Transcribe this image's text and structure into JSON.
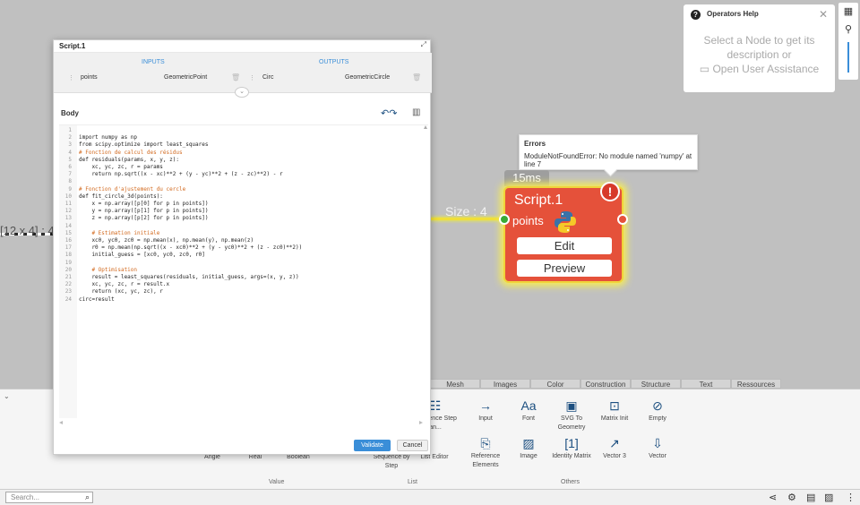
{
  "canvas": {
    "left_wire_label": "[12 x 4] : 4",
    "right_wire_label": "Size : 4"
  },
  "node": {
    "timing": "15ms",
    "title": "Script.1",
    "alert": "!",
    "port_label": "points",
    "edit_label": "Edit",
    "preview_label": "Preview",
    "color": "#e5513a"
  },
  "error": {
    "title": "Errors",
    "message": "ModuleNotFoundError: No module named 'numpy' at line 7"
  },
  "help": {
    "title": "Operators Help",
    "line1": "Select a Node to get its",
    "line2": "description or",
    "line3": "Open User Assistance"
  },
  "modal": {
    "title": "Script.1",
    "inputs_label": "INPUTS",
    "outputs_label": "OUTPUTS",
    "input_name": "points",
    "input_type": "GeometricPoint",
    "output_name": "Circ",
    "output_type": "GeometricCircle",
    "body_label": "Body",
    "validate_label": "Validate",
    "cancel_label": "Cancel",
    "code_lines": [
      "",
      "import numpy as np",
      "from scipy.optimize import least_squares",
      "# Fonction de calcul des résidus",
      "def residuals(params, x, y, z):",
      "    xc, yc, zc, r = params",
      "    return np.sqrt((x - xc)**2 + (y - yc)**2 + (z - zc)**2) - r",
      "",
      "# Fonction d'ajustement du cercle",
      "def fit_circle_3d(points):",
      "    x = np.array([p[0] for p in points])",
      "    y = np.array([p[1] for p in points])",
      "    z = np.array([p[2] for p in points])",
      "",
      "    # Estimation initiale",
      "    xc0, yc0, zc0 = np.mean(x), np.mean(y), np.mean(z)",
      "    r0 = np.mean(np.sqrt((x - xc0)**2 + (y - yc0)**2 + (z - zc0)**2))",
      "    initial_guess = [xc0, yc0, zc0, r0]",
      "",
      "    # Optimisation",
      "    result = least_squares(residuals, initial_guess, args=(x, y, z))",
      "    xc, yc, zc, r = result.x",
      "    return (xc, yc, zc), r",
      "circ=result"
    ]
  },
  "library": {
    "tabs": [
      "Mesh",
      "Images",
      "Color",
      "Construction",
      "Structure",
      "Text",
      "Ressources"
    ],
    "items": [
      {
        "label": "Sequence Step an...",
        "icon": "sequence-icon"
      },
      {
        "label": "Input",
        "icon": "input-icon"
      },
      {
        "label": "Font",
        "icon": "font-icon"
      },
      {
        "label": "SVG To Geometry",
        "icon": "svg-icon"
      },
      {
        "label": "Matrix Init",
        "icon": "matrix-icon"
      },
      {
        "label": "Empty",
        "icon": "empty-icon"
      },
      {
        "label": "Angle",
        "icon": ""
      },
      {
        "label": "Real",
        "icon": ""
      },
      {
        "label": "Boolean",
        "icon": ""
      },
      {
        "label": "Sequence by Step",
        "icon": ""
      },
      {
        "label": "List Editor",
        "icon": ""
      },
      {
        "label": "Reference Elements",
        "icon": "reference-icon"
      },
      {
        "label": "Image",
        "icon": "image-icon"
      },
      {
        "label": "Identity Matrix",
        "icon": "identity-matrix-icon"
      },
      {
        "label": "Vector 3",
        "icon": "vector3-icon"
      },
      {
        "label": "Vector",
        "icon": "vector-icon"
      }
    ],
    "groups": [
      "Value",
      "List",
      "Others"
    ]
  },
  "search": {
    "placeholder": "Search..."
  }
}
